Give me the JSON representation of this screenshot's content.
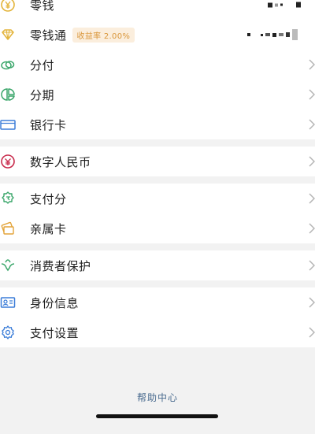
{
  "sections": [
    {
      "items": [
        {
          "label": "零钱",
          "icon": "yuan-coin-icon"
        },
        {
          "label": "零钱通",
          "icon": "diamond-icon",
          "badge": "收益率 2.00%"
        },
        {
          "label": "分付",
          "icon": "fenfu-cloud-icon"
        },
        {
          "label": "分期",
          "icon": "installment-icon"
        },
        {
          "label": "银行卡",
          "icon": "bank-card-icon"
        }
      ]
    },
    {
      "items": [
        {
          "label": "数字人民币",
          "icon": "digital-rmb-icon"
        }
      ]
    },
    {
      "items": [
        {
          "label": "支付分",
          "icon": "payment-score-icon"
        },
        {
          "label": "亲属卡",
          "icon": "family-card-icon"
        }
      ]
    },
    {
      "items": [
        {
          "label": "消费者保护",
          "icon": "consumer-protection-icon"
        }
      ]
    },
    {
      "items": [
        {
          "label": "身份信息",
          "icon": "id-card-icon"
        },
        {
          "label": "支付设置",
          "icon": "gear-icon"
        }
      ]
    }
  ],
  "footer": {
    "help_label": "帮助中心"
  },
  "colors": {
    "chevron": "#b5b5b5",
    "badge_text": "#d9963a",
    "badge_bg": "#fbeedd",
    "help_link": "#4a6b8f"
  }
}
